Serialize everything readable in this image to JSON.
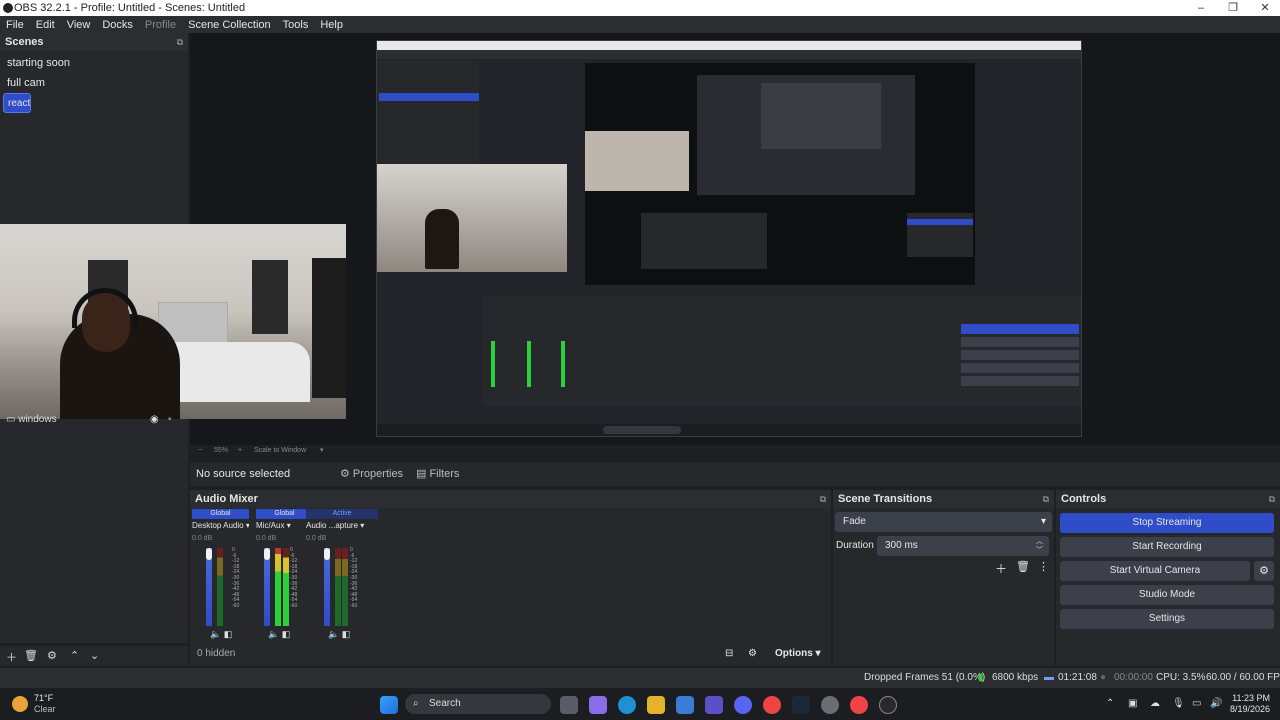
{
  "window": {
    "title": "OBS 32.2.1 - Profile: Untitled - Scenes: Untitled",
    "controls": [
      "–",
      "❐",
      "✕"
    ]
  },
  "menu": {
    "items": [
      "File",
      "Edit",
      "View",
      "Docks",
      "Profile",
      "Scene Collection",
      "Tools",
      "Help"
    ]
  },
  "scenes": {
    "header": "Scenes",
    "items": [
      "starting soon",
      "full cam",
      "react"
    ],
    "selected": "react",
    "source_visible": "windows"
  },
  "preview": {
    "zoom": "55%",
    "scale_mode": "Scale to Window"
  },
  "source_bar": {
    "no_source": "No source selected",
    "properties": "Properties",
    "filters": "Filters"
  },
  "audio_mixer": {
    "header": "Audio Mixer",
    "channels": [
      {
        "tag": "Global",
        "name": "Desktop Audio",
        "db": "0.0 dB"
      },
      {
        "tag": "Global",
        "name": "Mic/Aux",
        "db": "0.0 dB"
      },
      {
        "tag": "Active",
        "name": "Audio ...apture",
        "db": "0.0 dB"
      }
    ],
    "scale": [
      "0",
      "-6",
      "-12",
      "-18",
      "-24",
      "-30",
      "-36",
      "-42",
      "-48",
      "-54",
      "-60"
    ],
    "hidden": "0 hidden",
    "options": "Options"
  },
  "scene_transitions": {
    "header": "Scene Transitions",
    "transition": "Fade",
    "duration_label": "Duration",
    "duration_value": "300 ms"
  },
  "controls": {
    "header": "Controls",
    "stop_streaming": "Stop Streaming",
    "start_recording": "Start Recording",
    "start_virtual_camera": "Start Virtual Camera",
    "studio_mode": "Studio Mode",
    "settings": "Settings"
  },
  "status": {
    "dropped": "Dropped Frames 51 (0.0%)",
    "bitrate": "6800 kbps",
    "stream_time": "01:21:08",
    "rec_time": "00:00:00",
    "cpu": "CPU: 3.5%",
    "fps": "60.00 / 60.00 FPS"
  },
  "taskbar": {
    "weather_temp": "71°F",
    "weather_desc": "Clear",
    "search": "Search",
    "time": "11:23 PM",
    "date": "8/19/2026"
  },
  "colors": {
    "accent": "#2f4cc9",
    "bg": "#1e1f22",
    "panel": "#26282c"
  }
}
